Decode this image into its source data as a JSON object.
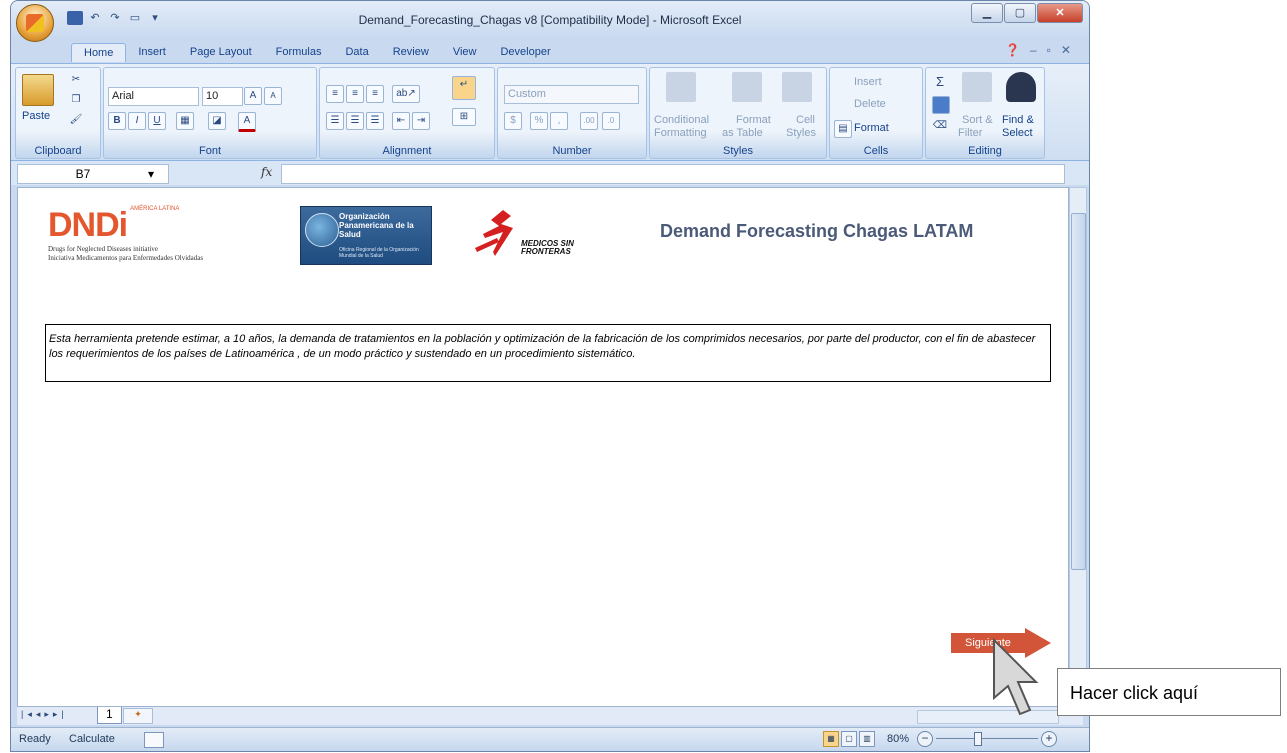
{
  "window": {
    "title": "Demand_Forecasting_Chagas v8  [Compatibility Mode] - Microsoft Excel"
  },
  "ribbon_tabs": [
    "Home",
    "Insert",
    "Page Layout",
    "Formulas",
    "Data",
    "Review",
    "View",
    "Developer"
  ],
  "active_tab": "Home",
  "ribbon": {
    "clipboard": {
      "label": "Clipboard",
      "paste": "Paste"
    },
    "font": {
      "label": "Font",
      "name": "Arial",
      "size": "10",
      "bold": "B",
      "italic": "I",
      "underline": "U",
      "grow": "A",
      "shrink": "A",
      "color": "A"
    },
    "alignment": {
      "label": "Alignment"
    },
    "number": {
      "label": "Number",
      "format": "Custom",
      "currency": "$",
      "percent": "%",
      "comma": ",",
      "inc_dec": ".00",
      "dec_dec": ".0"
    },
    "styles": {
      "label": "Styles",
      "conditional_1": "Conditional",
      "conditional_2": "Formatting",
      "table_1": "Format",
      "table_2": "as Table",
      "cell_1": "Cell",
      "cell_2": "Styles"
    },
    "cells": {
      "label": "Cells",
      "insert": "Insert",
      "delete": "Delete",
      "format": "Format"
    },
    "editing": {
      "label": "Editing",
      "sort_1": "Sort &",
      "sort_2": "Filter",
      "find_1": "Find &",
      "find_2": "Select",
      "sigma": "Σ"
    }
  },
  "formula_bar": {
    "name_box": "B7",
    "fx": "fx",
    "value": ""
  },
  "sheet": {
    "dndi_logo": "DNDi",
    "dndi_region": "AMÉRICA LATINA",
    "dndi_line1": "Drugs for Neglected Diseases initiative",
    "dndi_line2": "Iniciativa Medicamentos para Enfermedades Olvidadas",
    "paho_name": "Organización Panamericana de la Salud",
    "paho_sub": "Oficina Regional de la Organización Mundial de la Salud",
    "msf_name": "MEDICOS SIN FRONTERAS",
    "title": "Demand Forecasting Chagas LATAM",
    "description": "Esta herramienta pretende estimar, a 10 años, la demanda de tratamientos en la población y optimización de la fabricación de los comprimidos necesarios, por parte del productor, con el fin de abastecer los requerimientos de los países de Latinoamérica , de un modo práctico y sustendado en un procedimiento sistemático.",
    "next_button": "Siguiente"
  },
  "sheet_tabs": [
    "1"
  ],
  "status_bar": {
    "ready": "Ready",
    "calculate": "Calculate",
    "zoom": "80%"
  },
  "callout": "Hacer click aquí",
  "colors": {
    "accent": "#d2553a",
    "title": "#4a5a78",
    "ribbon_text": "#15428b"
  }
}
